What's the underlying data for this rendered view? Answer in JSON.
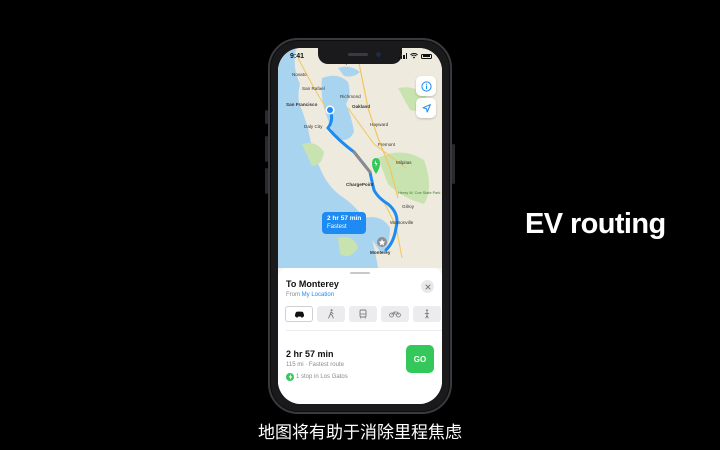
{
  "status_bar": {
    "time": "9:41"
  },
  "map": {
    "labels": {
      "novato": "Novato",
      "vallejo": "Vallejo",
      "san_rafael": "San Rafael",
      "richmond": "Richmond",
      "san_francisco": "San Francisco",
      "oakland": "Oakland",
      "hayward": "Hayward",
      "daly_city": "Daly City",
      "fremont": "Fremont",
      "milpitas": "Milpitas",
      "chargepoint": "ChargePoint",
      "henry_cowell": "Henry W. Coe State Park",
      "gilroy": "Gilroy",
      "watsonville": "Watsonville",
      "monterey": "Monterey"
    },
    "route_callout": {
      "time": "2 hr 57 min",
      "label": "Fastest"
    },
    "colors": {
      "route": "#1d8bf2",
      "water": "#a9d4ef",
      "land": "#eeeadd",
      "park": "#c9e3b0"
    }
  },
  "sheet": {
    "destination": "To Monterey",
    "from_prefix": "From",
    "from_link": "My Location",
    "modes": [
      "car-icon",
      "walk-icon",
      "transit-icon",
      "bike-icon",
      "rideshare-icon"
    ],
    "duration": "2 hr 57 min",
    "summary": "115 mi · Fastest route",
    "stops": "1 stop in Los Gatos",
    "go_label": "GO"
  },
  "headline": "EV routing",
  "caption": "地图将有助于消除里程焦虑"
}
